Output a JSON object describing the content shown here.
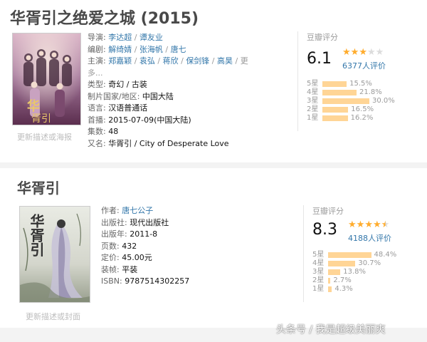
{
  "movie": {
    "title": "华胥引之绝爱之城 (2015)",
    "cover_caption": "更新描述或海报",
    "director_label": "导演: ",
    "directors": [
      "李达超",
      "谭友业"
    ],
    "writer_label": "编剧: ",
    "writers": [
      "解绮婧",
      "张海帆",
      "唐七"
    ],
    "cast_label": "主演: ",
    "cast_line1": [
      "郑嘉颖",
      "袁弘",
      "蒋欣",
      "保剑锋",
      "高昊",
      "更"
    ],
    "cast_more": "多...",
    "genre_label": "类型: ",
    "genre_value": "奇幻 / 古装",
    "country_label": "制片国家/地区: ",
    "country_value": "中国大陆",
    "language_label": "语言: ",
    "language_value": "汉语普通话",
    "premiere_label": "首播: ",
    "premiere_value": "2015-07-09(中国大陆)",
    "episodes_label": "集数: ",
    "episodes_value": "48",
    "aka_label": "又名: ",
    "aka_value": "华胥引 / City of Desperate Love",
    "rating": {
      "header": "豆瓣评分",
      "score": "6.1",
      "stars_on": 3,
      "count_text": "6377人评价",
      "dist": [
        {
          "label": "5星",
          "pct": "15.5%",
          "value": 15.5
        },
        {
          "label": "4星",
          "pct": "21.8%",
          "value": 21.8
        },
        {
          "label": "3星",
          "pct": "30.0%",
          "value": 30.0
        },
        {
          "label": "2星",
          "pct": "16.5%",
          "value": 16.5
        },
        {
          "label": "1星",
          "pct": "16.2%",
          "value": 16.2
        }
      ]
    }
  },
  "book": {
    "title": "华胥引",
    "cover_caption": "更新描述或封面",
    "author_label": "作者: ",
    "author_value": "唐七公子",
    "publisher_label": "出版社: ",
    "publisher_value": "现代出版社",
    "year_label": "出版年: ",
    "year_value": "2011-8",
    "pages_label": "页数: ",
    "pages_value": "432",
    "price_label": "定价: ",
    "price_value": "45.00元",
    "binding_label": "装帧: ",
    "binding_value": "平装",
    "isbn_label": "ISBN: ",
    "isbn_value": "9787514302257",
    "cover_title": "华胥引",
    "rating": {
      "header": "豆瓣评分",
      "score": "8.3",
      "stars_on": 4.5,
      "count_text": "4188人评价",
      "dist": [
        {
          "label": "5星",
          "pct": "48.4%",
          "value": 48.4
        },
        {
          "label": "4星",
          "pct": "30.7%",
          "value": 30.7
        },
        {
          "label": "3星",
          "pct": "13.8%",
          "value": 13.8
        },
        {
          "label": "2星",
          "pct": "2.7%",
          "value": 2.7
        },
        {
          "label": "1星",
          "pct": "4.3%",
          "value": 4.3
        }
      ]
    }
  },
  "watermark": "头条号 / 我是超级美丽爽",
  "colors": {
    "link": "#3377aa",
    "star": "#ffac2d",
    "bar": "#ffd596",
    "muted": "#9b9b9b"
  }
}
